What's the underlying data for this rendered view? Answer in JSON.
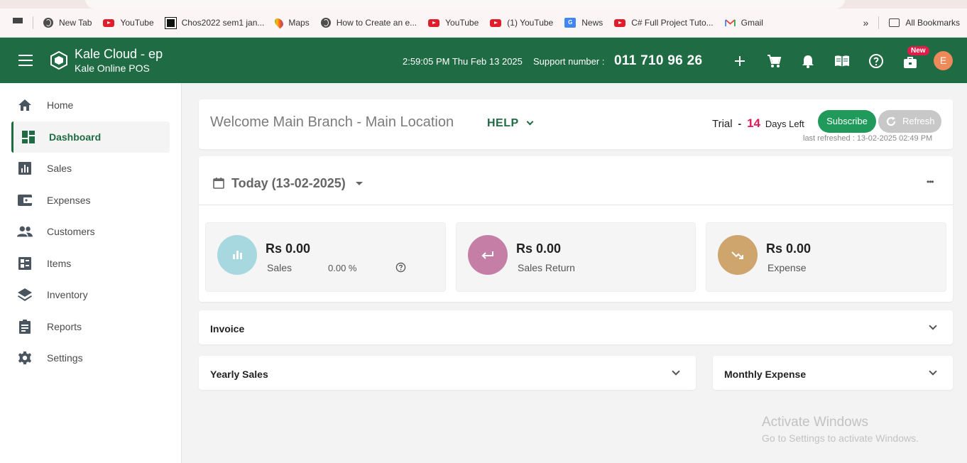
{
  "bookmarks": [
    {
      "label": "New Tab",
      "icon": "globe-icon"
    },
    {
      "label": "YouTube",
      "icon": "youtube-icon"
    },
    {
      "label": "Chos2022 sem1 jan...",
      "icon": "chos-icon"
    },
    {
      "label": "Maps",
      "icon": "maps-icon"
    },
    {
      "label": "How to Create an e...",
      "icon": "globe-icon"
    },
    {
      "label": "YouTube",
      "icon": "youtube-icon"
    },
    {
      "label": "(1) YouTube",
      "icon": "youtube-icon"
    },
    {
      "label": "News",
      "icon": "news-icon"
    },
    {
      "label": "C# Full Project Tuto...",
      "icon": "youtube-icon"
    },
    {
      "label": "Gmail",
      "icon": "gmail-icon"
    }
  ],
  "bookmarks_more": "»",
  "all_bookmarks": "All Bookmarks",
  "news_icon_text": "G",
  "header": {
    "title": "Kale Cloud - ep",
    "subtitle": "Kale Online POS",
    "datetime": "2:59:05 PM Thu Feb 13 2025",
    "support_label": "Support number :",
    "support_number": "011 710 96 26",
    "new_badge": "New",
    "avatar_letter": "E",
    "brand_color": "#1f6b44"
  },
  "sidebar": {
    "items": [
      {
        "label": "Home",
        "icon": "home-icon"
      },
      {
        "label": "Dashboard",
        "icon": "dashboard-icon",
        "active": true
      },
      {
        "label": "Sales",
        "icon": "bar-chart-icon"
      },
      {
        "label": "Expenses",
        "icon": "wallet-icon"
      },
      {
        "label": "Customers",
        "icon": "people-icon"
      },
      {
        "label": "Items",
        "icon": "items-icon"
      },
      {
        "label": "Inventory",
        "icon": "layers-icon"
      },
      {
        "label": "Reports",
        "icon": "clipboard-icon"
      },
      {
        "label": "Settings",
        "icon": "gear-icon"
      }
    ]
  },
  "welcome": {
    "text": "Welcome Main Branch - Main Location",
    "help": "HELP",
    "trial_label": "Trial",
    "trial_dash": "-",
    "trial_days": "14",
    "days_left": "Days Left",
    "subscribe": "Subscribe",
    "refresh": "Refresh",
    "last_refreshed": "last refreshed : 13-02-2025 02:49 PM"
  },
  "period": {
    "label": "Today (13-02-2025)",
    "more": "•••"
  },
  "stats": [
    {
      "amount": "Rs 0.00",
      "label": "Sales",
      "percent": "0.00 %",
      "color": "#a7d8e0",
      "icon": "bar-chart-icon"
    },
    {
      "amount": "Rs 0.00",
      "label": "Sales Return",
      "color": "#c57fa6",
      "icon": "return-arrow-icon"
    },
    {
      "amount": "Rs 0.00",
      "label": "Expense",
      "color": "#cda56d",
      "icon": "trending-down-icon"
    }
  ],
  "sections": {
    "invoice": "Invoice",
    "yearly_sales": "Yearly Sales",
    "monthly_expense": "Monthly Expense"
  },
  "watermark": {
    "line1": "Activate Windows",
    "line2": "Go to Settings to activate Windows."
  }
}
